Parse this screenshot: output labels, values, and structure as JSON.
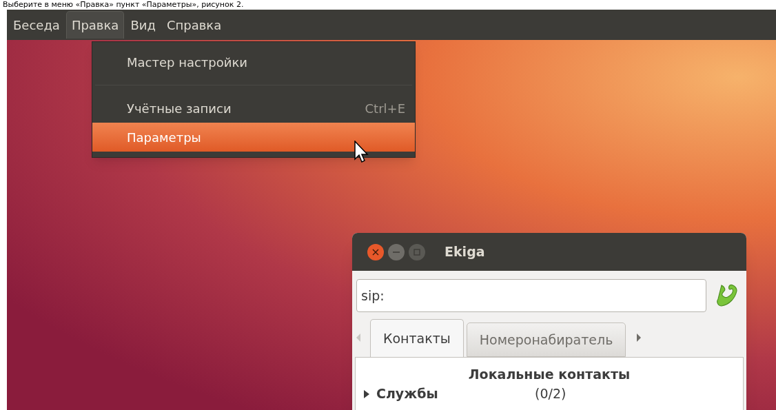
{
  "caption": "Выберите в меню «Правка» пункт «Параметры», рисунок 2.",
  "menubar": [
    {
      "label": "Беседа",
      "selected": false
    },
    {
      "label": "Правка",
      "selected": true
    },
    {
      "label": "Вид",
      "selected": false
    },
    {
      "label": "Справка",
      "selected": false
    }
  ],
  "menu": [
    {
      "kind": "item",
      "label": "Мастер настройки",
      "selected": false
    },
    {
      "kind": "separator"
    },
    {
      "kind": "item",
      "label": "Учётные записи",
      "shortcut": "Ctrl+E",
      "selected": false
    },
    {
      "kind": "item",
      "label": "Параметры",
      "selected": true
    }
  ],
  "window": {
    "title": "Ekiga",
    "address": {
      "value": "sip:"
    },
    "tabs": [
      {
        "label": "Контакты",
        "selected": true
      },
      {
        "label": "Номеронабиратель",
        "selected": false
      }
    ],
    "heading": "Локальные контакты",
    "groups": [
      {
        "name": "Службы",
        "count": "(0/2)",
        "expanded": false
      }
    ]
  }
}
